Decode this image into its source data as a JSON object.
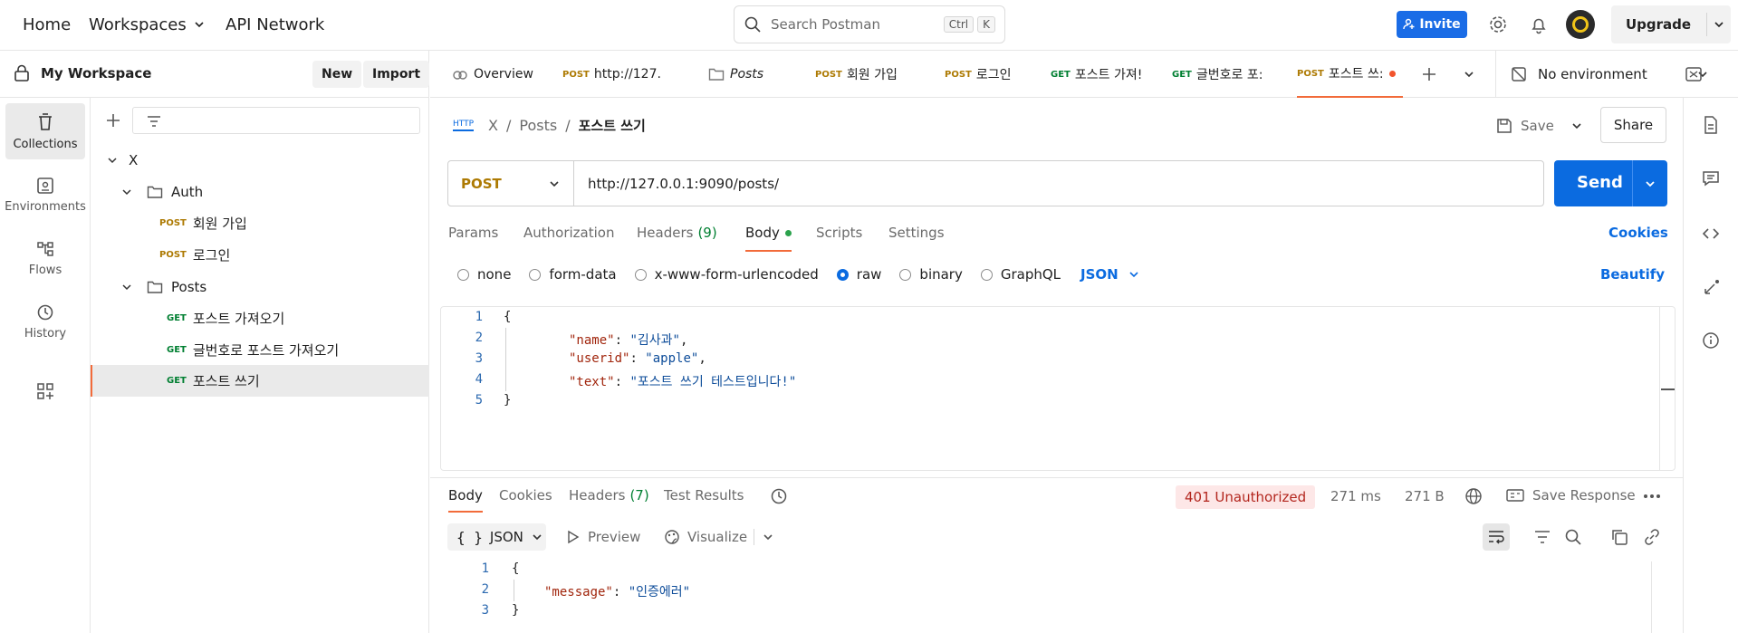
{
  "topbar": {
    "home": "Home",
    "workspaces": "Workspaces",
    "api_network": "API Network",
    "search_placeholder": "Search Postman",
    "kbd_ctrl": "Ctrl",
    "kbd_k": "K",
    "invite": "Invite",
    "upgrade": "Upgrade"
  },
  "workspace": {
    "title": "My Workspace",
    "new": "New",
    "import": "Import"
  },
  "sidebar": {
    "items": [
      {
        "label": "Collections",
        "icon": "trash-can-icon"
      },
      {
        "label": "Environments",
        "icon": "environment-icon"
      },
      {
        "label": "Flows",
        "icon": "flows-icon"
      },
      {
        "label": "History",
        "icon": "history-icon"
      }
    ]
  },
  "tree": {
    "root": "X",
    "auth_folder": "Auth",
    "posts_folder": "Posts",
    "items": [
      {
        "method": "POST",
        "label": "회원 가입"
      },
      {
        "method": "POST",
        "label": "로그인"
      },
      {
        "method": "GET",
        "label": "포스트 가져오기"
      },
      {
        "method": "GET",
        "label": "글번호로 포스트 가져오기"
      },
      {
        "method": "GET",
        "label": "포스트 쓰기"
      }
    ]
  },
  "tabs": {
    "overview": "Overview",
    "items": [
      {
        "method": "POST",
        "label": "http://127."
      },
      {
        "method": "",
        "label": "Posts"
      },
      {
        "method": "POST",
        "label": "회원 가입"
      },
      {
        "method": "POST",
        "label": "로그인"
      },
      {
        "method": "GET",
        "label": "포스트 가져!"
      },
      {
        "method": "GET",
        "label": "글번호로 포:"
      },
      {
        "method": "POST",
        "label": "포스트 쓰:"
      }
    ],
    "environment": "No environment"
  },
  "breadcrumb": {
    "http": "HTTP",
    "root": "X",
    "sep": "/",
    "folder": "Posts",
    "current": "포스트 쓰기"
  },
  "actions": {
    "save": "Save",
    "share": "Share"
  },
  "request": {
    "method": "POST",
    "url": "http://127.0.0.1:9090/posts/",
    "send": "Send",
    "cookies": "Cookies",
    "beautify": "Beautify"
  },
  "req_tabs": {
    "params": "Params",
    "authorization": "Authorization",
    "headers": "Headers",
    "headers_count": "(9)",
    "body": "Body",
    "scripts": "Scripts",
    "settings": "Settings"
  },
  "body_types": {
    "none": "none",
    "form_data": "form-data",
    "urlencoded": "x-www-form-urlencoded",
    "raw": "raw",
    "binary": "binary",
    "graphql": "GraphQL",
    "format": "JSON"
  },
  "request_body": {
    "lines": [
      "1",
      "2",
      "3",
      "4",
      "5"
    ],
    "open": "{",
    "close": "}",
    "k1": "\"name\"",
    "v1": "\"김사과\"",
    "k2": "\"userid\"",
    "v2": "\"apple\"",
    "k3": "\"text\"",
    "v3": "\"포스트 쓰기 테스트입니다!\""
  },
  "response": {
    "tabs": {
      "body": "Body",
      "cookies": "Cookies",
      "headers": "Headers",
      "headers_count": "(7)",
      "test_results": "Test Results"
    },
    "status": "401 Unauthorized",
    "time": "271 ms",
    "size": "271 B",
    "save_response": "Save Response",
    "format": "JSON",
    "preview": "Preview",
    "visualize": "Visualize",
    "lines": [
      "1",
      "2",
      "3"
    ],
    "open": "{",
    "close": "}",
    "key": "\"message\"",
    "value": "\"인증에러\""
  },
  "colors": {
    "accent": "#0b6be0",
    "post": "#ad7a03",
    "get": "#007f31",
    "active_tab": "#f26b3a"
  }
}
